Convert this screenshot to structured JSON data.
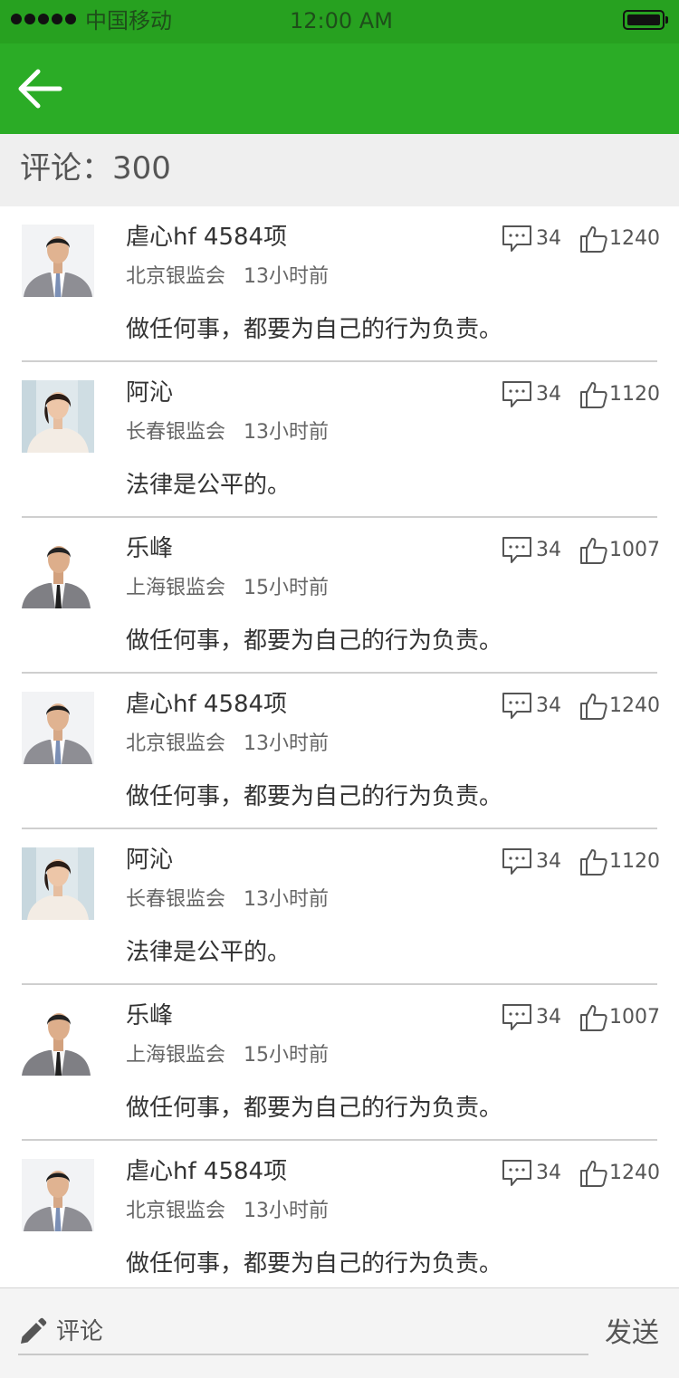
{
  "status_bar": {
    "carrier": "中国移动",
    "time": "12:00 AM"
  },
  "nav": {
    "back_icon": "arrow-left-icon"
  },
  "comments_header": {
    "label": "评论：300"
  },
  "comments": [
    {
      "avatar": "man",
      "name": "虐心hf 4584项",
      "org": "北京银监会",
      "time": "13小时前",
      "replies": "34",
      "likes": "1240",
      "text": "做任何事，都要为自己的行为负责。"
    },
    {
      "avatar": "woman",
      "name": "阿沁",
      "org": "长春银监会",
      "time": "13小时前",
      "replies": "34",
      "likes": "1120",
      "text": "法律是公平的。"
    },
    {
      "avatar": "man2",
      "name": "乐峰",
      "org": "上海银监会",
      "time": "15小时前",
      "replies": "34",
      "likes": "1007",
      "text": "做任何事，都要为自己的行为负责。"
    },
    {
      "avatar": "man",
      "name": "虐心hf 4584项",
      "org": "北京银监会",
      "time": "13小时前",
      "replies": "34",
      "likes": "1240",
      "text": "做任何事，都要为自己的行为负责。"
    },
    {
      "avatar": "woman",
      "name": "阿沁",
      "org": "长春银监会",
      "time": "13小时前",
      "replies": "34",
      "likes": "1120",
      "text": "法律是公平的。"
    },
    {
      "avatar": "man2",
      "name": "乐峰",
      "org": "上海银监会",
      "time": "15小时前",
      "replies": "34",
      "likes": "1007",
      "text": "做任何事，都要为自己的行为负责。"
    },
    {
      "avatar": "man",
      "name": "虐心hf 4584项",
      "org": "北京银监会",
      "time": "13小时前",
      "replies": "34",
      "likes": "1240",
      "text": "做任何事，都要为自己的行为负责。"
    }
  ],
  "composer": {
    "placeholder": "评论",
    "send_label": "发送"
  },
  "colors": {
    "status_bar": "#27a120",
    "nav_bar": "#2bac26",
    "header_bg": "#efefef"
  }
}
